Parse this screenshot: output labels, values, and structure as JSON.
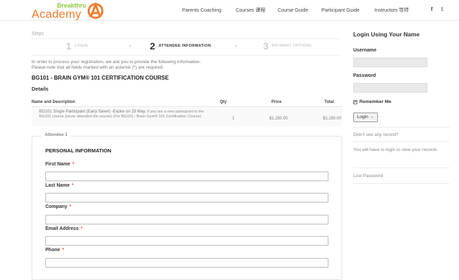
{
  "logo": {
    "top": "Breakthru",
    "main": "Academy"
  },
  "nav": {
    "items": [
      "Parents Coaching",
      "Courses 课程",
      "Course Guide",
      "Participant Guide",
      "Instructors 导师"
    ]
  },
  "social": {
    "facebook": "f",
    "twitter": "𝕥"
  },
  "steps": {
    "label": "Steps",
    "items": [
      {
        "num": "1",
        "label": "LOGIN"
      },
      {
        "num": "2",
        "label": "ATTENDEE INFORMATION"
      },
      {
        "num": "3",
        "label": "PAYMENT OPTIONS"
      }
    ],
    "arrow": "»"
  },
  "notes": [
    "In order to process your registration, we ask you to provide the following information.",
    "Please note that all fields marked with an asterisk (*) are required."
  ],
  "course": {
    "title": "BG101 - BRAIN GYM® 101 CERTIFICATION COURSE",
    "details": "Details"
  },
  "table": {
    "headers": [
      "Name and Description",
      "Qty",
      "Price",
      "Total"
    ],
    "row": {
      "desc_main": "BG101 Single Participant (Early Saver) -Expire on 25 May.",
      "desc_sub": " If you are a new participant to the BG101 course (never attended the course) (For BG101 - Brain Gym® 101 Certification Course)",
      "qty": "1",
      "price": "$1,150.00",
      "total": "$1,150.00"
    }
  },
  "attendee": {
    "legend": "Attendee 1",
    "section": "PERSONAL INFORMATION",
    "required_mark": "*",
    "fields": [
      "First Name",
      "Last Name",
      "Company",
      "Email Address",
      "Phone"
    ]
  },
  "sidebar": {
    "title": "Login Using Your Name",
    "username_label": "Username",
    "password_label": "Password",
    "remember": "Remember Me",
    "remember_check": "✔",
    "login_button": "Login →",
    "links": [
      "Didn't see any record?",
      "You will have to login to view your records",
      "Lost Password"
    ]
  }
}
